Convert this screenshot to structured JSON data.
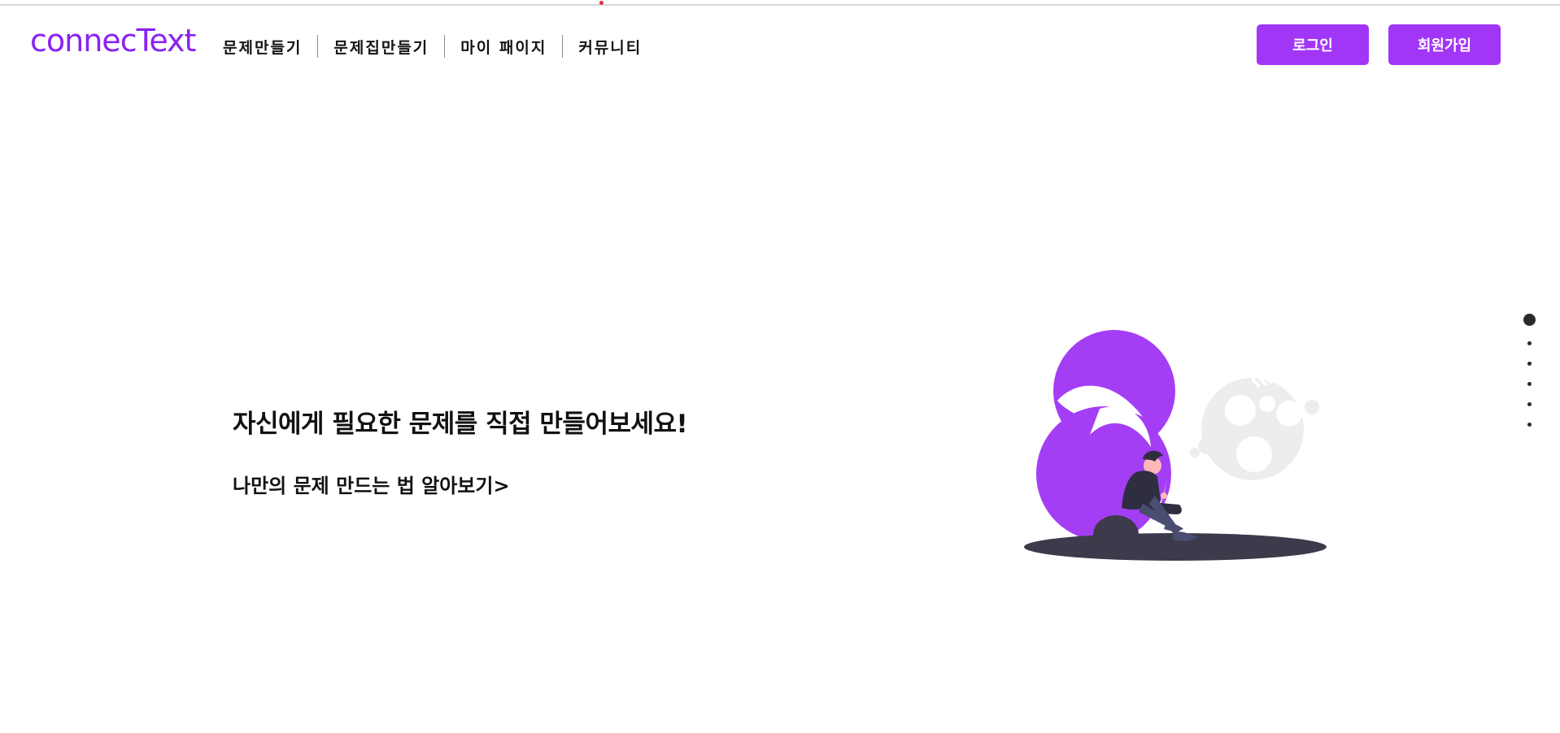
{
  "header": {
    "logo": "connecText",
    "nav": [
      {
        "label": "문제만들기"
      },
      {
        "label": "문제집만들기"
      },
      {
        "label": "마이 패이지"
      },
      {
        "label": "커뮤니티"
      }
    ],
    "login_label": "로그인",
    "signup_label": "회원가입"
  },
  "hero": {
    "title": "자신에게 필요한 문제를 직접 만들어보세요!",
    "link": "나만의 문제 만드는 법 알아보기>"
  },
  "pagination": {
    "total": 6,
    "active_index": 0
  },
  "colors": {
    "brand": "#8a22f2",
    "button": "#a236f7",
    "illustration_purple": "#a43ef5",
    "illustration_gray": "#ededed",
    "figure_dark": "#3d3a4b"
  },
  "icons": {
    "illustration": "person-sitting-thought-bubble-illustration"
  }
}
